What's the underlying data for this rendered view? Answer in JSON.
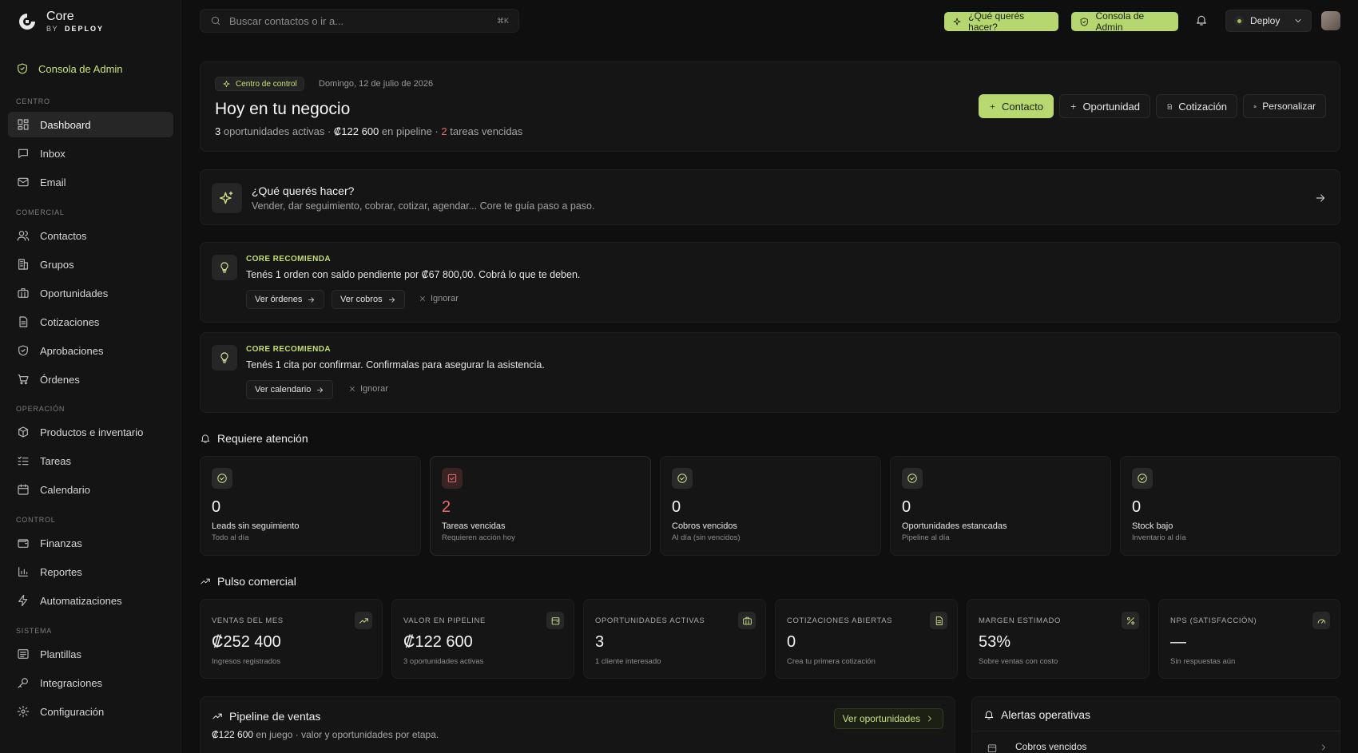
{
  "brand": {
    "name": "Core",
    "by": "BY",
    "company": "DEPLOY"
  },
  "sidebar": {
    "admin_label": "Consola de Admin",
    "sections": [
      {
        "title": "CENTRO",
        "items": [
          {
            "label": "Dashboard",
            "icon": "dashboard-icon",
            "active": true
          },
          {
            "label": "Inbox",
            "icon": "inbox-icon"
          },
          {
            "label": "Email",
            "icon": "mail-icon"
          }
        ]
      },
      {
        "title": "COMERCIAL",
        "items": [
          {
            "label": "Contactos",
            "icon": "users-icon"
          },
          {
            "label": "Grupos",
            "icon": "building-icon"
          },
          {
            "label": "Oportunidades",
            "icon": "briefcase-icon"
          },
          {
            "label": "Cotizaciones",
            "icon": "document-icon"
          },
          {
            "label": "Aprobaciones",
            "icon": "shield-check-icon"
          },
          {
            "label": "Órdenes",
            "icon": "cart-icon"
          }
        ]
      },
      {
        "title": "OPERACIÓN",
        "items": [
          {
            "label": "Productos e inventario",
            "icon": "box-icon"
          },
          {
            "label": "Tareas",
            "icon": "list-check-icon"
          },
          {
            "label": "Calendario",
            "icon": "calendar-icon"
          }
        ]
      },
      {
        "title": "CONTROL",
        "items": [
          {
            "label": "Finanzas",
            "icon": "wallet-icon"
          },
          {
            "label": "Reportes",
            "icon": "bar-chart-icon"
          },
          {
            "label": "Automatizaciones",
            "icon": "bolt-icon"
          }
        ]
      },
      {
        "title": "SISTEMA",
        "items": [
          {
            "label": "Plantillas",
            "icon": "template-icon"
          },
          {
            "label": "Integraciones",
            "icon": "key-icon"
          },
          {
            "label": "Configuración",
            "icon": "gear-icon"
          }
        ]
      }
    ]
  },
  "topbar": {
    "search_placeholder": "Buscar contactos o ir a...",
    "search_shortcut": "⌘K",
    "ask_button": "¿Qué querés hacer?",
    "admin_button": "Consola de Admin",
    "workspace": "Deploy"
  },
  "hero": {
    "tag": "Centro de control",
    "date": "Domingo, 12 de julio de 2026",
    "title": "Hoy en tu negocio",
    "active_count": "3",
    "active_text": "oportunidades activas",
    "pipeline_value": "₡122 600",
    "pipeline_text": "en pipeline",
    "overdue_count": "2",
    "overdue_text": "tareas vencidas",
    "btn_contact": "Contacto",
    "btn_opportunity": "Oportunidad",
    "btn_quote": "Cotización",
    "btn_customize": "Personalizar"
  },
  "ask": {
    "title": "¿Qué querés hacer?",
    "subtitle": "Vender, dar seguimiento, cobrar, cotizar, agendar... Core te guía paso a paso."
  },
  "recommendations": [
    {
      "label": "CORE RECOMIENDA",
      "text": "Tenés 1 orden con saldo pendiente por ₡67 800,00. Cobrá lo que te deben.",
      "actions": [
        "Ver órdenes",
        "Ver cobros"
      ],
      "ignore": "Ignorar"
    },
    {
      "label": "CORE RECOMIENDA",
      "text": "Tenés 1 cita por confirmar. Confirmalas para asegurar la asistencia.",
      "actions": [
        "Ver calendario"
      ],
      "ignore": "Ignorar"
    }
  ],
  "attention": {
    "title": "Requiere atención",
    "cards": [
      {
        "value": "0",
        "label": "Leads sin seguimiento",
        "sub": "Todo al día",
        "alert": false
      },
      {
        "value": "2",
        "label": "Tareas vencidas",
        "sub": "Requieren acción hoy",
        "alert": true
      },
      {
        "value": "0",
        "label": "Cobros vencidos",
        "sub": "Al día (sin vencidos)",
        "alert": false
      },
      {
        "value": "0",
        "label": "Oportunidades estancadas",
        "sub": "Pipeline al día",
        "alert": false
      },
      {
        "value": "0",
        "label": "Stock bajo",
        "sub": "Inventario al día",
        "alert": false
      }
    ]
  },
  "pulse": {
    "title": "Pulso comercial",
    "kpis": [
      {
        "label": "VENTAS DEL MES",
        "value": "₡252 400",
        "sub": "Ingresos registrados",
        "icon": "trend-up-icon"
      },
      {
        "label": "VALOR EN PIPELINE",
        "value": "₡122 600",
        "sub": "3 oportunidades activas",
        "icon": "wallet-icon"
      },
      {
        "label": "OPORTUNIDADES ACTIVAS",
        "value": "3",
        "sub": "1 cliente interesado",
        "icon": "briefcase-icon"
      },
      {
        "label": "COTIZACIONES ABIERTAS",
        "value": "0",
        "sub": "Crea tu primera cotización",
        "icon": "document-icon"
      },
      {
        "label": "MARGEN ESTIMADO",
        "value": "53%",
        "sub": "Sobre ventas con costo",
        "icon": "percent-icon"
      },
      {
        "label": "NPS (SATISFACCIÓN)",
        "value": "—",
        "sub": "Sin respuestas aún",
        "icon": "gauge-icon"
      }
    ]
  },
  "pipeline": {
    "title": "Pipeline de ventas",
    "value": "₡122 600",
    "text": "en juego · valor y oportunidades por etapa.",
    "button": "Ver oportunidades"
  },
  "alerts": {
    "title": "Alertas operativas",
    "items": [
      {
        "label": "Cobros vencidos"
      }
    ]
  },
  "colors": {
    "accent": "#b8d870",
    "alert": "#e86b6b",
    "background": "#0f0f0f",
    "card": "#151515"
  }
}
